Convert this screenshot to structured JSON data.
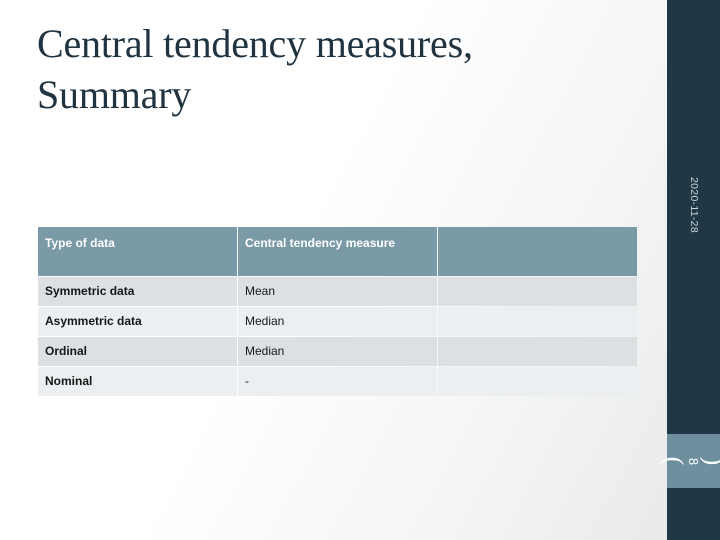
{
  "slide": {
    "title": "Central tendency measures,\nSummary",
    "date": "2020-11-28",
    "slide_number": "8",
    "bracket_left": "(",
    "bracket_right": ")",
    "colors": {
      "title_text": "#1f3340",
      "sidebar": "#203845",
      "slide_number_block": "#6d8f9e",
      "table_header": "#7b9aa8",
      "row_dark": "#dce0e3",
      "row_light": "#eceff1"
    }
  },
  "table": {
    "headers": [
      "Type of data",
      "Central tendency measure",
      ""
    ],
    "rows": [
      {
        "type_of_data": "Symmetric data",
        "measure": "Mean",
        "extra": ""
      },
      {
        "type_of_data": "Asymmetric data",
        "measure": "Median",
        "extra": ""
      },
      {
        "type_of_data": "Ordinal",
        "measure": "Median",
        "extra": ""
      },
      {
        "type_of_data": "Nominal",
        "measure": "-",
        "extra": ""
      }
    ]
  }
}
